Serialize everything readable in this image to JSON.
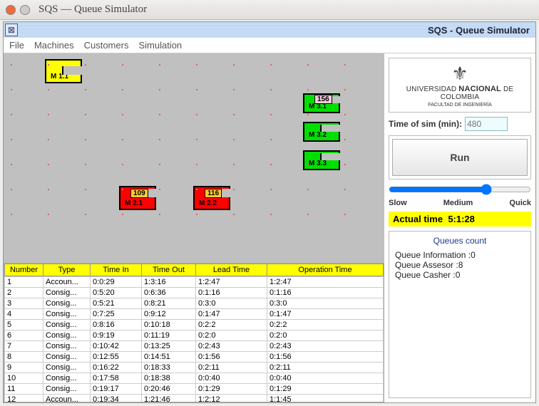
{
  "window": {
    "title": "SQS — Queue Simulator",
    "inner_title": "SQS - Queue Simulator"
  },
  "menu": {
    "file": "File",
    "machines": "Machines",
    "customers": "Customers",
    "simulation": "Simulation"
  },
  "machines": {
    "m11": "M 1.1",
    "m21": "M 2.1",
    "m22": "M 2.2",
    "m31": "M 3.1",
    "m32": "M 3.2",
    "m33": "M 3.3"
  },
  "tickets": {
    "t109": "109",
    "t116": "116",
    "t156": "156"
  },
  "table": {
    "headers": [
      "Number",
      "Type",
      "Time In",
      "Time Out",
      "Lead Time",
      "Operation Time"
    ],
    "rows": [
      [
        "1",
        "Accoun...",
        "0:0:29",
        "1:3:16",
        "1:2:47",
        "1:2:47"
      ],
      [
        "2",
        "Consig...",
        "0:5:20",
        "0:6:36",
        "0:1:16",
        "0:1:16"
      ],
      [
        "3",
        "Consig...",
        "0:5:21",
        "0:8:21",
        "0:3:0",
        "0:3:0"
      ],
      [
        "4",
        "Consig...",
        "0:7:25",
        "0:9:12",
        "0:1:47",
        "0:1:47"
      ],
      [
        "5",
        "Consig...",
        "0:8:16",
        "0:10:18",
        "0:2:2",
        "0:2:2"
      ],
      [
        "6",
        "Consig...",
        "0:9:19",
        "0:11:19",
        "0:2:0",
        "0:2:0"
      ],
      [
        "7",
        "Consig...",
        "0:10:42",
        "0:13:25",
        "0:2:43",
        "0:2:43"
      ],
      [
        "8",
        "Consig...",
        "0:12:55",
        "0:14:51",
        "0:1:56",
        "0:1:56"
      ],
      [
        "9",
        "Consig...",
        "0:16:22",
        "0:18:33",
        "0:2:11",
        "0:2:11"
      ],
      [
        "10",
        "Consig...",
        "0:17:58",
        "0:18:38",
        "0:0:40",
        "0:0:40"
      ],
      [
        "11",
        "Consig...",
        "0:19:17",
        "0:20:46",
        "0:1:29",
        "0:1:29"
      ],
      [
        "12",
        "Accoun...",
        "0:19:34",
        "1:21:46",
        "1:2:12",
        "1:1:45"
      ]
    ]
  },
  "logo": {
    "line1": "UNIVERSIDAD",
    "line2": "NACIONAL",
    "line3": "DE COLOMBIA",
    "faculty": "FACULTAD DE INGENIERÍA"
  },
  "sim": {
    "time_label": "Time of sim (min):",
    "time_placeholder": "480",
    "run": "Run",
    "slow": "Slow",
    "medium": "Medium",
    "quick": "Quick",
    "actual_label": "Actual time",
    "actual_value": "5:1:28"
  },
  "queues": {
    "title": "Queues count",
    "info_label": "Queue Information :",
    "info_val": "0",
    "asse_label": "Queue Assesor :",
    "asse_val": "8",
    "cash_label": "Queue Casher :",
    "cash_val": "0"
  }
}
